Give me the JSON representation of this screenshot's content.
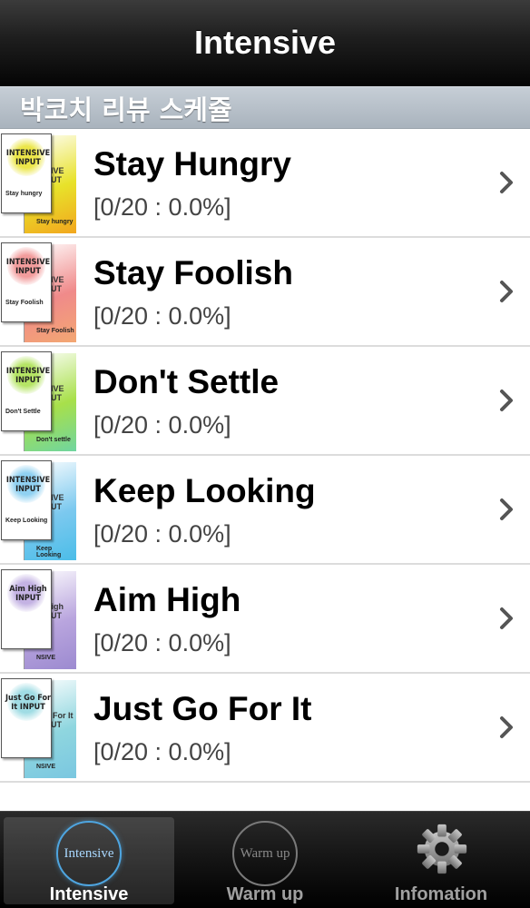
{
  "navbar": {
    "title": "Intensive"
  },
  "section": {
    "header": "박코치 리뷰 스케쥴"
  },
  "items": [
    {
      "name": "Stay Hungry",
      "progress": "[0/20 : 0.0%]",
      "thumb": {
        "badge": "INTENSIVE INPUT",
        "sub": "Stay hungry",
        "back": "Stay hungry",
        "tag": "SIVE PUT",
        "accent": "#e8e22a",
        "accent2": "#f2a61e"
      }
    },
    {
      "name": "Stay Foolish",
      "progress": "[0/20 : 0.0%]",
      "thumb": {
        "badge": "INTENSIVE INPUT",
        "sub": "Stay Foolish",
        "back": "Stay Foolish",
        "tag": "SIVE PUT",
        "accent": "#f08a8a",
        "accent2": "#f3a772"
      }
    },
    {
      "name": "Don't Settle",
      "progress": "[0/20 : 0.0%]",
      "thumb": {
        "badge": "INTENSIVE INPUT",
        "sub": "Don't Settle",
        "back": "Don't settle",
        "tag": "SIVE PUT",
        "accent": "#a8e04a",
        "accent2": "#6fd5a0"
      }
    },
    {
      "name": "Keep Looking",
      "progress": "[0/20 : 0.0%]",
      "thumb": {
        "badge": "INTENSIVE INPUT",
        "sub": "Keep Looking",
        "back": "Keep Looking",
        "tag": "SIVE PUT",
        "accent": "#7cc9ef",
        "accent2": "#4bbde8"
      }
    },
    {
      "name": "Aim High",
      "progress": "[0/20 : 0.0%]",
      "thumb": {
        "badge": "Aim High INPUT",
        "sub": "",
        "back": "NSIVE",
        "tag": "High PUT",
        "accent": "#b9a5de",
        "accent2": "#9c8ad0"
      }
    },
    {
      "name": "Just Go For It",
      "progress": "[0/20 : 0.0%]",
      "thumb": {
        "badge": "Just Go For It INPUT",
        "sub": "",
        "back": "NSIVE",
        "tag": "o For It PUT",
        "accent": "#8fd6df",
        "accent2": "#7ac7e0"
      }
    }
  ],
  "tabs": [
    {
      "label": "Intensive",
      "icon_text": "Intensive",
      "icon": "intensive-circle-icon",
      "selected": true
    },
    {
      "label": "Warm up",
      "icon_text": "Warm up",
      "icon": "warm-up-circle-icon",
      "selected": false
    },
    {
      "label": "Infomation",
      "icon": "gear-icon",
      "selected": false
    }
  ]
}
